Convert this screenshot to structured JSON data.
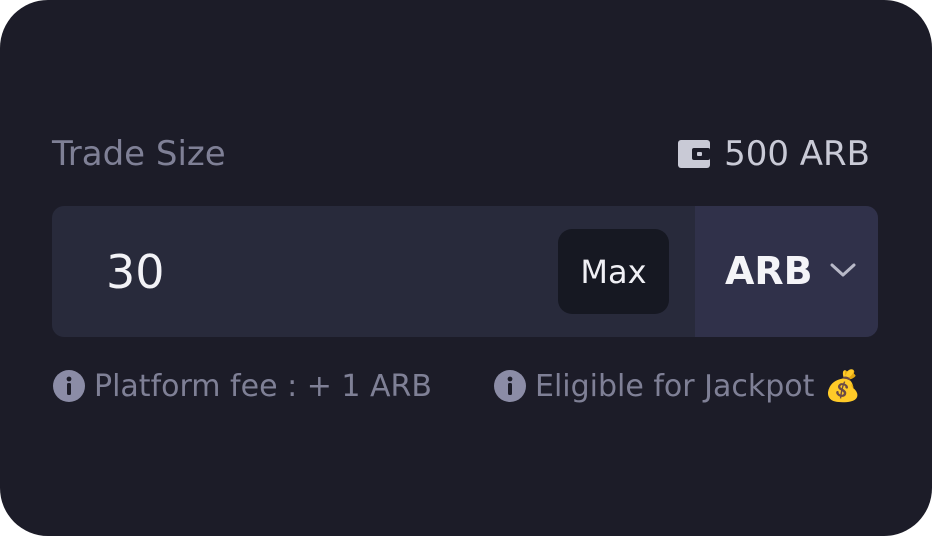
{
  "trade": {
    "label": "Trade Size",
    "balance_text": "500 ARB",
    "amount_value": "30",
    "max_label": "Max",
    "token": "ARB"
  },
  "footer": {
    "fee_text": "Platform fee : + 1 ARB",
    "jackpot_text": "Eligible for Jackpot 💰"
  },
  "icons": {
    "wallet": "wallet-icon",
    "info": "info-icon",
    "chevron": "chevron-down-icon"
  },
  "colors": {
    "card_bg": "#1c1c28",
    "input_bg": "#282a3b",
    "selector_bg": "#30314a",
    "max_bg": "#161822",
    "muted_text": "#7f8096"
  }
}
